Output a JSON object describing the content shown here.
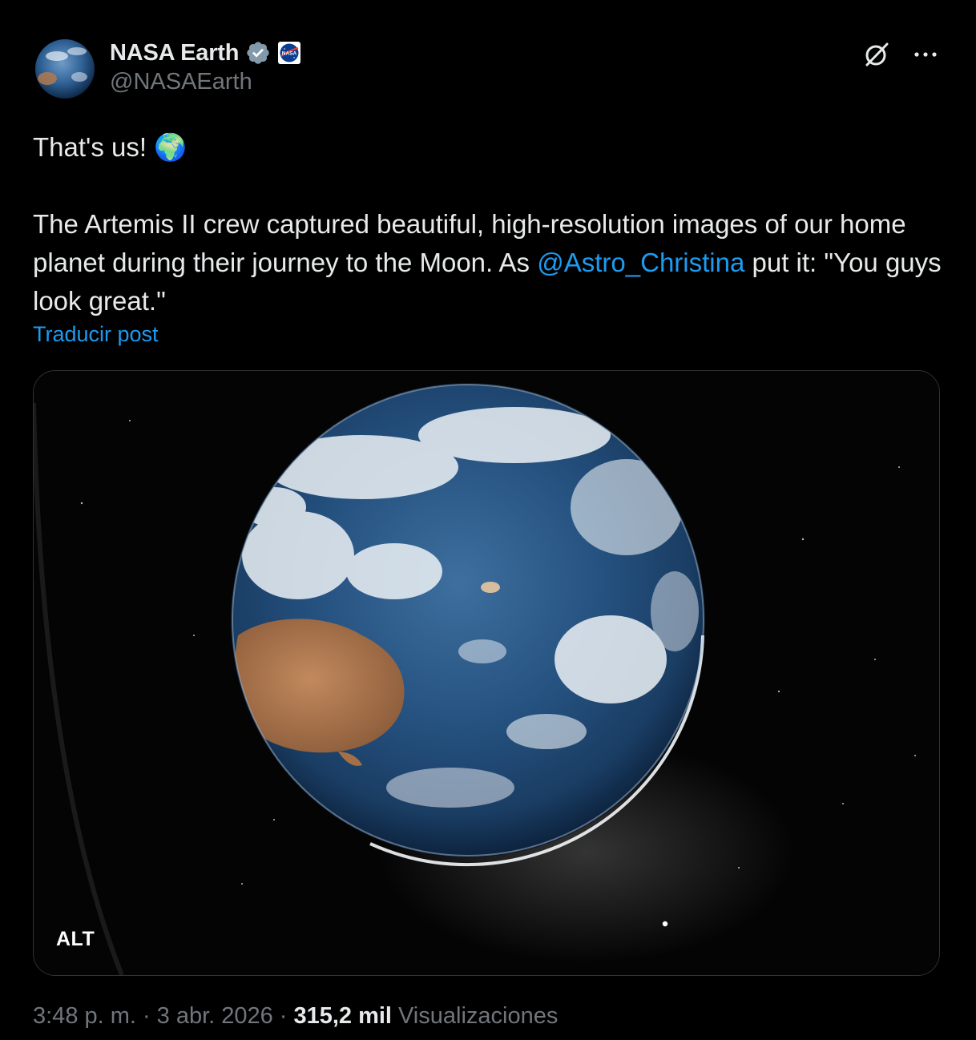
{
  "post": {
    "author": {
      "display_name": "NASA Earth",
      "handle": "@NASAEarth",
      "verified_icon": "verified-badge-icon",
      "affiliate_icon": "nasa-logo-icon",
      "avatar_icon": "earth-avatar-icon"
    },
    "top_actions": {
      "grok_icon": "grok-icon",
      "more_icon": "more-options-icon",
      "more_label": "···"
    },
    "text": {
      "line1": "That's us!",
      "emoji": "🌍",
      "para2_before": "The Artemis II crew captured beautiful, high-resolution images of our home planet during their journey to the Moon. As ",
      "mention": "@Astro_Christina",
      "para2_after": " put it: \"You guys look great.\""
    },
    "translate_label": "Traducir post",
    "media": {
      "alt_label": "ALT"
    },
    "meta": {
      "time": "3:48 p. m.",
      "separator": "·",
      "date": "3 abr. 2026",
      "views_count": "315,2 mil",
      "views_label": "Visualizaciones"
    }
  },
  "colors": {
    "background": "#000000",
    "text": "#e7e9ea",
    "secondary_text": "#71767b",
    "link": "#1d9bf0",
    "border": "#2f3336",
    "verified_badge": "#829aab"
  }
}
